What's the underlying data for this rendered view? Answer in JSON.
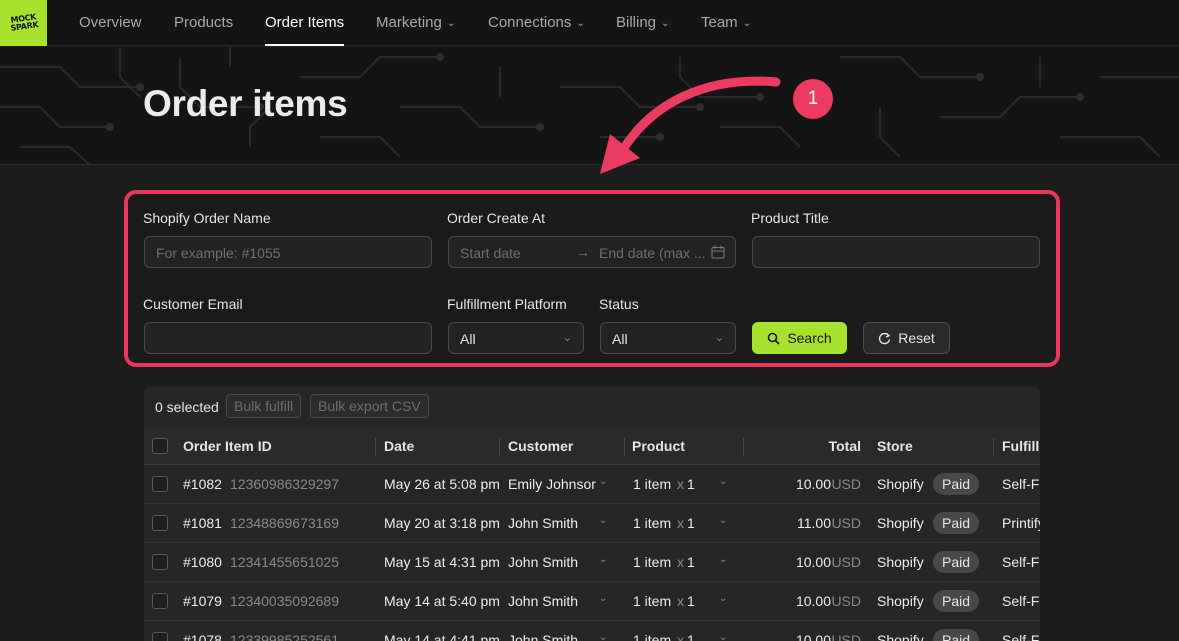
{
  "nav": {
    "logo": "MOCK SPARK",
    "items": [
      {
        "label": "Overview",
        "dropdown": false,
        "active": false
      },
      {
        "label": "Products",
        "dropdown": false,
        "active": false
      },
      {
        "label": "Order Items",
        "dropdown": false,
        "active": true
      },
      {
        "label": "Marketing",
        "dropdown": true,
        "active": false
      },
      {
        "label": "Connections",
        "dropdown": true,
        "active": false
      },
      {
        "label": "Billing",
        "dropdown": true,
        "active": false
      },
      {
        "label": "Team",
        "dropdown": true,
        "active": false
      }
    ]
  },
  "page": {
    "title": "Order items"
  },
  "annotation": {
    "step": "1",
    "color": "#ec3b61"
  },
  "filters": {
    "shopify_order_name": {
      "label": "Shopify Order Name",
      "placeholder": "For example: #1055"
    },
    "order_create_at": {
      "label": "Order Create At",
      "start_placeholder": "Start date",
      "end_placeholder": "End date (max ..."
    },
    "product_title": {
      "label": "Product Title",
      "value": ""
    },
    "customer_email": {
      "label": "Customer Email",
      "value": ""
    },
    "fulfillment_platform": {
      "label": "Fulfillment Platform",
      "value": "All"
    },
    "status": {
      "label": "Status",
      "value": "All"
    },
    "search_label": "Search",
    "reset_label": "Reset"
  },
  "table": {
    "selected_text": "0 selected",
    "bulk_fulfill": "Bulk fulfill",
    "bulk_export": "Bulk export CSV",
    "columns": [
      "Order Item ID",
      "Date",
      "Customer",
      "Product",
      "Total",
      "Store",
      "Fulfillm"
    ],
    "rows": [
      {
        "order": "#1082",
        "id": "12360986329297",
        "date": "May 26 at 5:08 pm",
        "customer": "Emily Johnsor",
        "product": "1 item",
        "qty": "1",
        "total": "10.00",
        "currency": "USD",
        "store": "Shopify",
        "status": "Paid",
        "fulfillment": "Self-Fu"
      },
      {
        "order": "#1081",
        "id": "12348869673169",
        "date": "May 20 at 3:18 pm",
        "customer": "John Smith",
        "product": "1 item",
        "qty": "1",
        "total": "11.00",
        "currency": "USD",
        "store": "Shopify",
        "status": "Paid",
        "fulfillment": "Printify"
      },
      {
        "order": "#1080",
        "id": "12341455651025",
        "date": "May 15 at 4:31 pm",
        "customer": "John Smith",
        "product": "1 item",
        "qty": "1",
        "total": "10.00",
        "currency": "USD",
        "store": "Shopify",
        "status": "Paid",
        "fulfillment": "Self-Fu"
      },
      {
        "order": "#1079",
        "id": "12340035092689",
        "date": "May 14 at 5:40 pm",
        "customer": "John Smith",
        "product": "1 item",
        "qty": "1",
        "total": "10.00",
        "currency": "USD",
        "store": "Shopify",
        "status": "Paid",
        "fulfillment": "Self-Fu"
      },
      {
        "order": "#1078",
        "id": "12339985252561",
        "date": "May 14 at 4:41 pm",
        "customer": "John Smith",
        "product": "1 item",
        "qty": "1",
        "total": "10.00",
        "currency": "USD",
        "store": "Shopify",
        "status": "Paid",
        "fulfillment": "Self-Fu"
      }
    ]
  },
  "colors": {
    "accent": "#a6e22e",
    "highlight": "#e8375a"
  }
}
